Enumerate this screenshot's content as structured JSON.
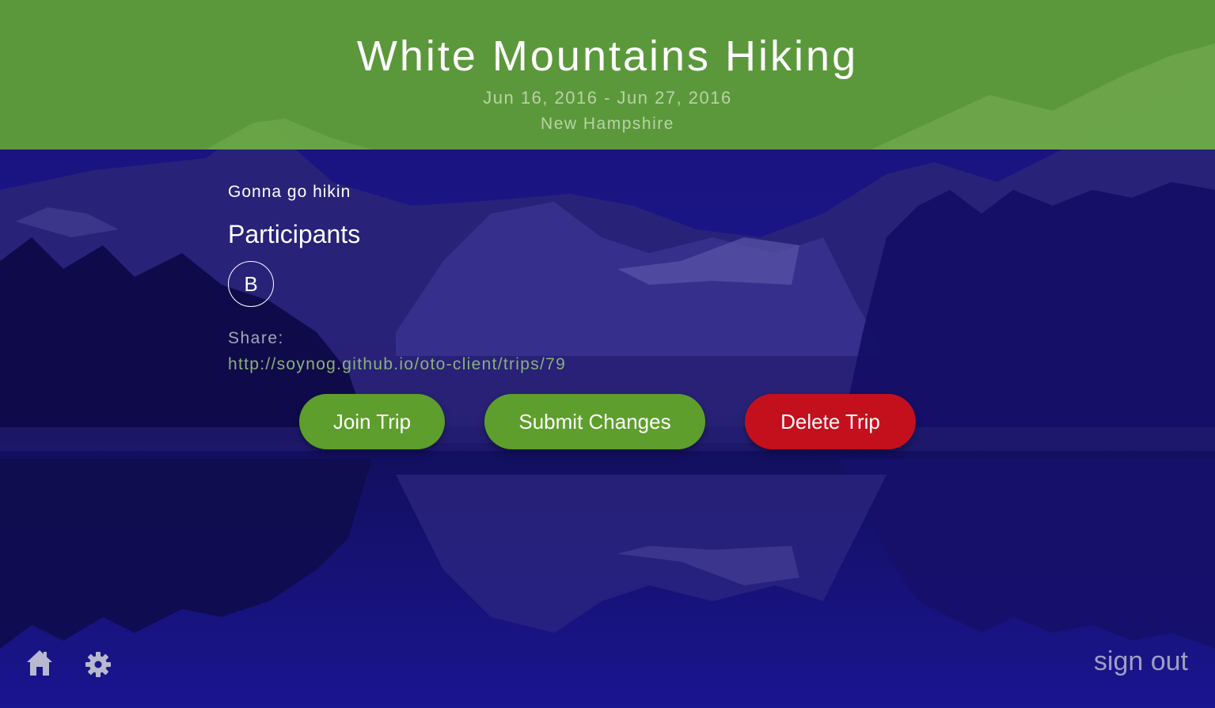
{
  "header": {
    "title": "White Mountains Hiking",
    "dates": "Jun 16, 2016 - Jun 27, 2016",
    "location": "New Hampshire"
  },
  "trip": {
    "description": "Gonna go hikin",
    "participants_heading": "Participants",
    "participants": [
      "B"
    ],
    "share_label": "Share:",
    "share_url": "http://soynog.github.io/oto-client/trips/79"
  },
  "actions": {
    "join_label": "Join Trip",
    "submit_label": "Submit Changes",
    "delete_label": "Delete Trip"
  },
  "footer": {
    "home_icon": "home-icon",
    "settings_icon": "gear-icon",
    "sign_out_label": "sign out"
  },
  "colors": {
    "header_green": "#5e9e38",
    "button_green": "#5e9e2c",
    "button_red": "#c4101d",
    "background_blue": "#1a1580"
  }
}
